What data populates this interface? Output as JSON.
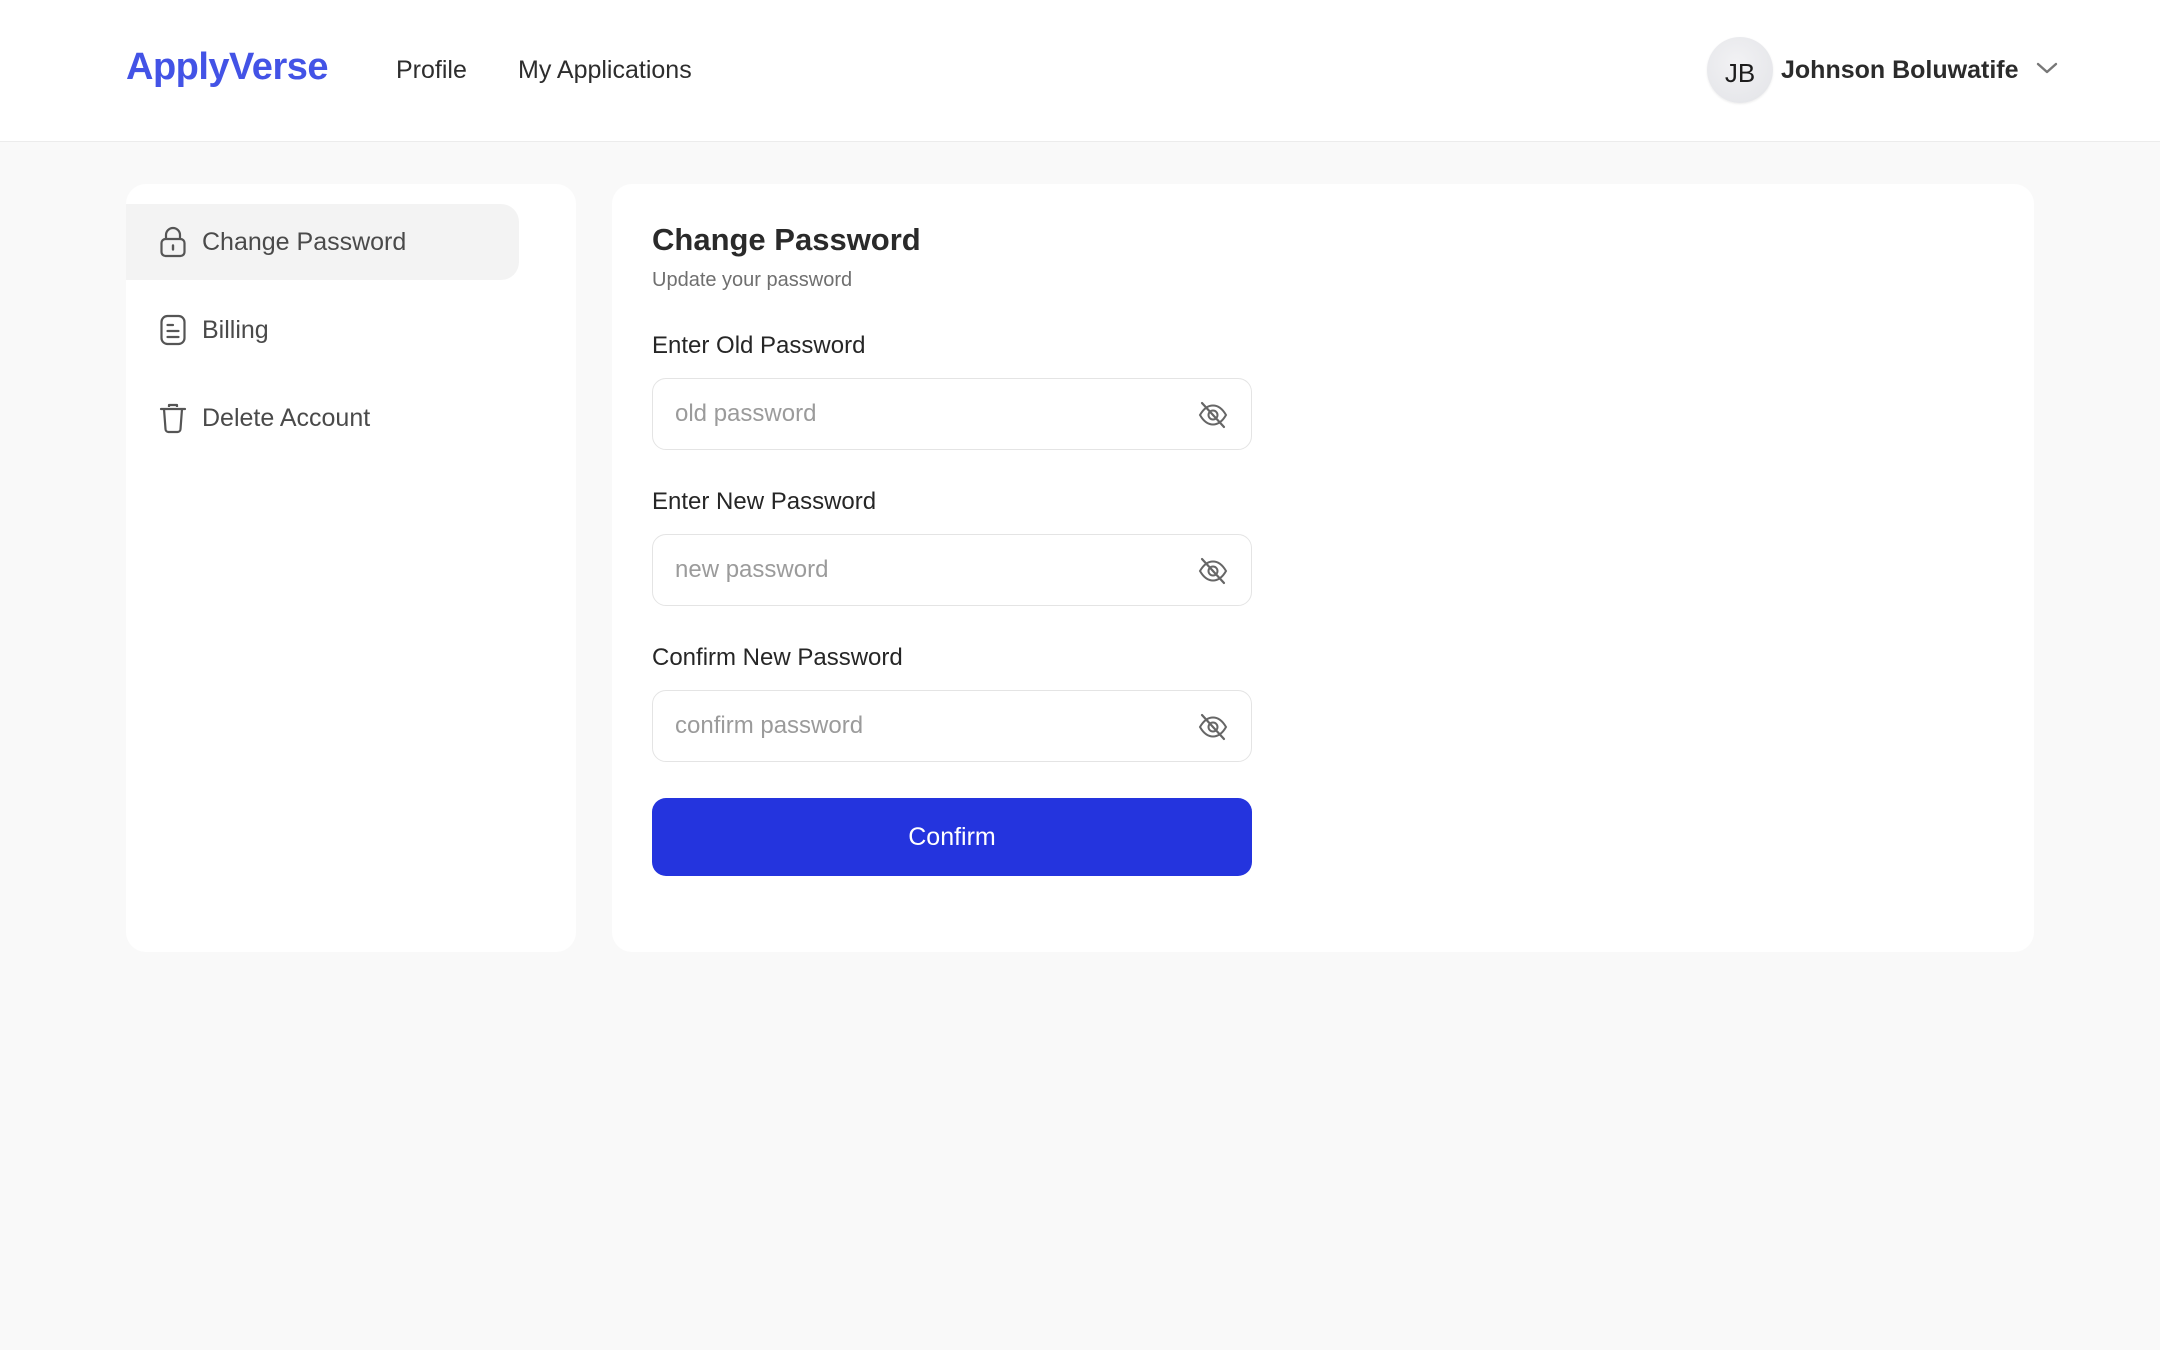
{
  "header": {
    "brand": "ApplyVerse",
    "nav": [
      {
        "label": "Profile"
      },
      {
        "label": "My Applications"
      }
    ],
    "user": {
      "initials": "JB",
      "name": "Johnson Boluwatife"
    }
  },
  "sidebar": {
    "items": [
      {
        "label": "Change Password",
        "icon": "lock-icon",
        "active": true
      },
      {
        "label": "Billing",
        "icon": "document-icon",
        "active": false
      },
      {
        "label": "Delete Account",
        "icon": "trash-icon",
        "active": false
      }
    ]
  },
  "form": {
    "title": "Change Password",
    "subtitle": "Update your password",
    "fields": [
      {
        "label": "Enter Old Password",
        "placeholder": "old password",
        "value": ""
      },
      {
        "label": "Enter New Password",
        "placeholder": "new password",
        "value": ""
      },
      {
        "label": "Confirm New Password",
        "placeholder": "confirm password",
        "value": ""
      }
    ],
    "submit_label": "Confirm"
  },
  "colors": {
    "brand": "#4353e6",
    "primary_button": "#2434de",
    "page_background": "#f9f9f9",
    "active_sidebar": "#f3f3f3"
  }
}
